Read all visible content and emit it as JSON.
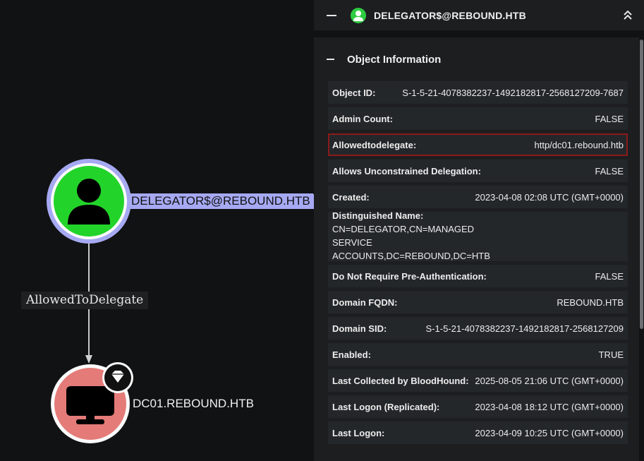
{
  "graph": {
    "user_node_label": "DELEGATOR$@REBOUND.HTB",
    "edge_label": "AllowedToDelegate",
    "dc_node_label": "DC01.REBOUND.HTB",
    "colors": {
      "user_node": "#22d42a",
      "user_ring": "#a6a9f2",
      "dc_node": "#e47b78"
    }
  },
  "panel": {
    "title": "DELEGATOR$@REBOUND.HTB",
    "section_title": "Object Information",
    "rows": [
      {
        "key": "Object ID:",
        "value": "S-1-5-21-4078382237-1492182817-2568127209-7687"
      },
      {
        "key": "Admin Count:",
        "value": "FALSE"
      },
      {
        "key": "Allowedtodelegate:",
        "value": "http/dc01.rebound.htb"
      },
      {
        "key": "Allows Unconstrained Delegation:",
        "value": "FALSE"
      },
      {
        "key": "Created:",
        "value": "2023-04-08 02:08 UTC (GMT+0000)"
      },
      {
        "key": "Distinguished Name:",
        "value": "CN=DELEGATOR,CN=MANAGED SERVICE ACCOUNTS,DC=REBOUND,DC=HTB"
      },
      {
        "key": "Do Not Require Pre-Authentication:",
        "value": "FALSE"
      },
      {
        "key": "Domain FQDN:",
        "value": "REBOUND.HTB"
      },
      {
        "key": "Domain SID:",
        "value": "S-1-5-21-4078382237-1492182817-2568127209"
      },
      {
        "key": "Enabled:",
        "value": "TRUE"
      },
      {
        "key": "Last Collected by BloodHound:",
        "value": "2025-08-05 21:06 UTC (GMT+0000)"
      },
      {
        "key": "Last Logon (Replicated):",
        "value": "2023-04-08 18:12 UTC (GMT+0000)"
      },
      {
        "key": "Last Logon:",
        "value": "2023-04-09 10:25 UTC (GMT+0000)"
      }
    ]
  }
}
